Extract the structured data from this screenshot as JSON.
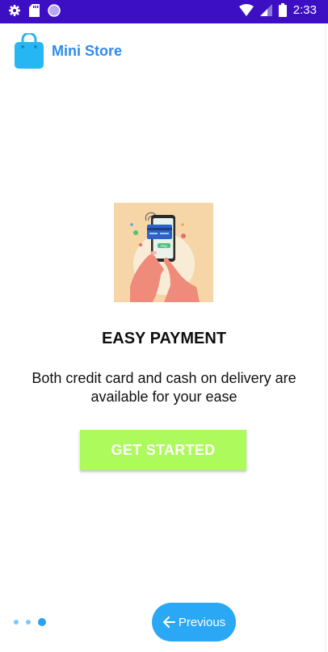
{
  "status_bar": {
    "time": "2:33",
    "icons_left": [
      "settings-icon",
      "sd-card-icon",
      "circle-icon"
    ],
    "icons_right": [
      "wifi-icon",
      "signal-icon",
      "battery-icon"
    ],
    "background": "#3d0fc4"
  },
  "app": {
    "title": "Mini Store",
    "logo_icon": "shopping-bag-icon",
    "brand_color": "#2e8bf0"
  },
  "onboarding": {
    "illustration": "phone-payment-illustration",
    "heading": "EASY PAYMENT",
    "description": "Both credit card and cash on delivery are available for your ease",
    "cta_label": "GET STARTED",
    "cta_color": "#acfa5c"
  },
  "pager": {
    "page_count": 3,
    "current_index": 2
  },
  "nav": {
    "previous_label": "Previous",
    "previous_icon": "arrow-left-icon",
    "button_color": "#2aa8f5"
  }
}
